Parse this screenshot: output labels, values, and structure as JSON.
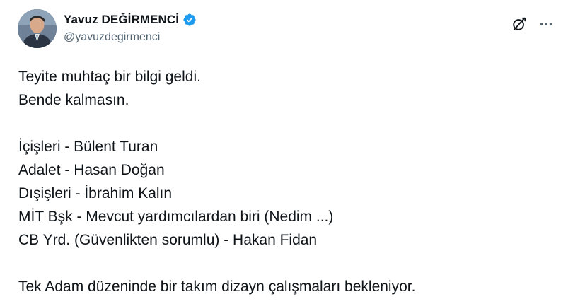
{
  "author": {
    "display_name": "Yavuz DEĞİRMENCİ",
    "handle": "@yavuzdegirmenci",
    "verified": true,
    "verified_color": "#1d9bf0",
    "avatar_icon": "profile-photo"
  },
  "actions": {
    "grok_icon": "grok-icon",
    "more_icon": "more-options-icon"
  },
  "tweet": {
    "lines": [
      "Teyite muhtaç bir bilgi geldi.",
      "Bende kalmasın.",
      "",
      "İçişleri - Bülent Turan",
      "Adalet - Hasan Doğan",
      "Dışişleri - İbrahim Kalın",
      "MİT Bşk - Mevcut yardımcılardan biri (Nedim ...)",
      "CB Yrd. (Güvenlikten sorumlu) - Hakan Fidan",
      "",
      "Tek Adam düzeninde bir takım dizayn çalışmaları bekleniyor."
    ]
  }
}
